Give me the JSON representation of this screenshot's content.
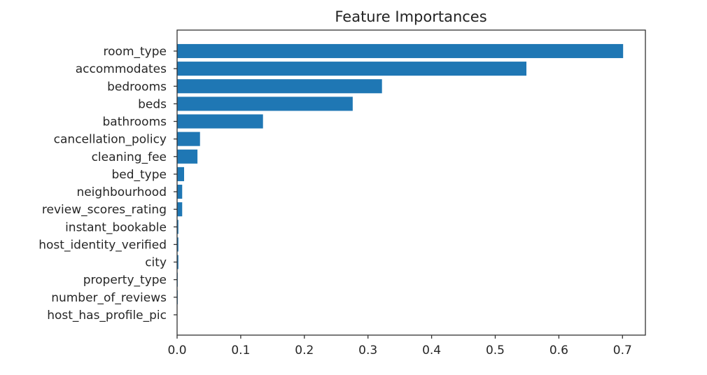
{
  "chart_data": {
    "type": "bar",
    "orientation": "horizontal",
    "title": "Feature Importances",
    "xlabel": "",
    "ylabel": "",
    "xlim": [
      0.0,
      0.736
    ],
    "grid": false,
    "legend": null,
    "bar_color": "#1f77b4",
    "categories": [
      "room_type",
      "accommodates",
      "bedrooms",
      "beds",
      "bathrooms",
      "cancellation_policy",
      "cleaning_fee",
      "bed_type",
      "neighbourhood",
      "review_scores_rating",
      "instant_bookable",
      "host_identity_verified",
      "city",
      "property_type",
      "number_of_reviews",
      "host_has_profile_pic"
    ],
    "values": [
      0.701,
      0.549,
      0.322,
      0.276,
      0.135,
      0.036,
      0.032,
      0.011,
      0.008,
      0.008,
      0.002,
      0.002,
      0.002,
      0.001,
      0.001,
      0.0
    ],
    "xticks": [
      0.0,
      0.1,
      0.2,
      0.3,
      0.4,
      0.5,
      0.6,
      0.7
    ],
    "xtick_labels": [
      "0.0",
      "0.1",
      "0.2",
      "0.3",
      "0.4",
      "0.5",
      "0.6",
      "0.7"
    ]
  }
}
